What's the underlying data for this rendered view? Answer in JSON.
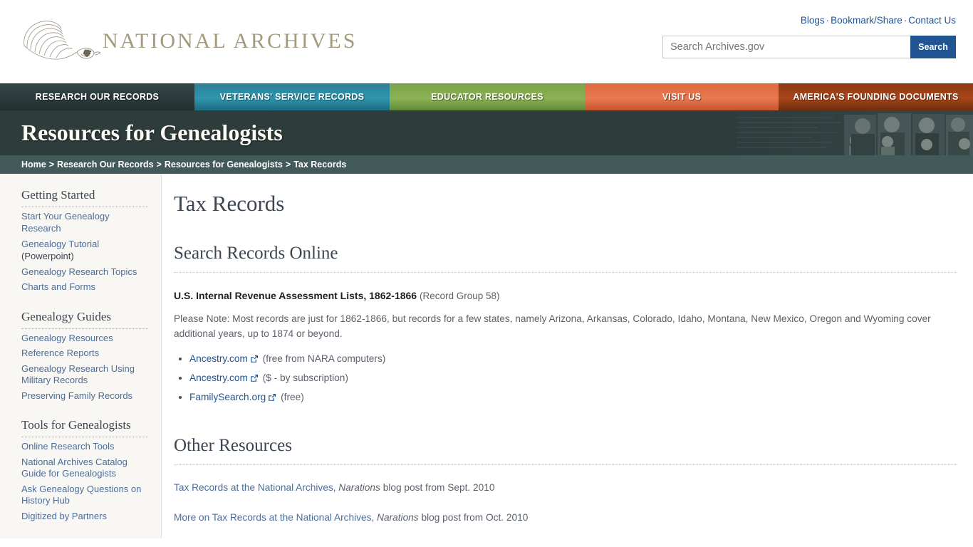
{
  "header": {
    "logo_text": "NATIONAL ARCHIVES",
    "logo_icon": "eagle-logo-icon",
    "util_links": [
      "Blogs",
      "Bookmark/Share",
      "Contact Us"
    ],
    "util_separator": "·",
    "search": {
      "placeholder": "Search Archives.gov",
      "value": "",
      "button_label": "Search",
      "button_color": "#205493"
    }
  },
  "nav": {
    "items": [
      {
        "label": "RESEARCH OUR RECORDS",
        "color": "#2c3b3d"
      },
      {
        "label": "VETERANS' SERVICE RECORDS",
        "color": "#2e96ae"
      },
      {
        "label": "EDUCATOR RESOURCES",
        "color": "#8cb254"
      },
      {
        "label": "VISIT US",
        "color": "#e87950"
      },
      {
        "label": "AMERICA'S FOUNDING DOCUMENTS",
        "color": "#a8451a"
      }
    ]
  },
  "banner": {
    "title": "Resources for Genealogists",
    "background_color": "#2e3c3c"
  },
  "breadcrumb": {
    "separator": ">",
    "items": [
      "Home",
      "Research Our Records",
      "Resources for Genealogists",
      "Tax Records"
    ]
  },
  "sidebar": {
    "groups": [
      {
        "heading": "Getting Started",
        "links": [
          {
            "label": "Start Your Genealogy Research"
          },
          {
            "label": "Genealogy Tutorial",
            "note": "(Powerpoint)"
          },
          {
            "label": "Genealogy Research Topics"
          },
          {
            "label": "Charts and Forms"
          }
        ]
      },
      {
        "heading": "Genealogy Guides",
        "links": [
          {
            "label": "Genealogy Resources"
          },
          {
            "label": "Reference Reports"
          },
          {
            "label": "Genealogy Research Using Military Records"
          },
          {
            "label": "Preserving Family Records"
          }
        ]
      },
      {
        "heading": "Tools for Genealogists",
        "links": [
          {
            "label": "Online Research Tools"
          },
          {
            "label": "National Archives Catalog Guide for Genealogists"
          },
          {
            "label": "Ask Genealogy Questions on History Hub"
          },
          {
            "label": "Digitized by Partners"
          }
        ]
      }
    ]
  },
  "main": {
    "page_title": "Tax Records",
    "section_1": {
      "heading": "Search Records Online",
      "record_title": "U.S. Internal Revenue Assessment Lists, 1862-1866",
      "record_group": "(Record Group 58)",
      "note": "Please Note:  Most records are just for 1862-1866, but records for a few states, namely Arizona, Arkansas, Colorado, Idaho, Montana, New Mexico, Oregon and Wyoming cover additional years, up to 1874 or beyond.",
      "links": [
        {
          "label": "Ancestry.com",
          "icon": "external-link-icon",
          "suffix": "(free from NARA computers)"
        },
        {
          "label": "Ancestry.com",
          "icon": "external-link-icon",
          "suffix": "($ - by subscription)"
        },
        {
          "label": "FamilySearch.org",
          "icon": "external-link-icon",
          "suffix": "(free)"
        }
      ]
    },
    "section_2": {
      "heading": "Other Resources",
      "resources": [
        {
          "link": "Tax Records at the National Archives",
          "comma": ",",
          "italic": "Narations",
          "tail": "blog post from Sept. 2010"
        },
        {
          "link": "More on Tax Records at the National Archives",
          "comma": ",",
          "italic": "Narations",
          "tail": "blog post from Oct. 2010"
        }
      ]
    }
  }
}
